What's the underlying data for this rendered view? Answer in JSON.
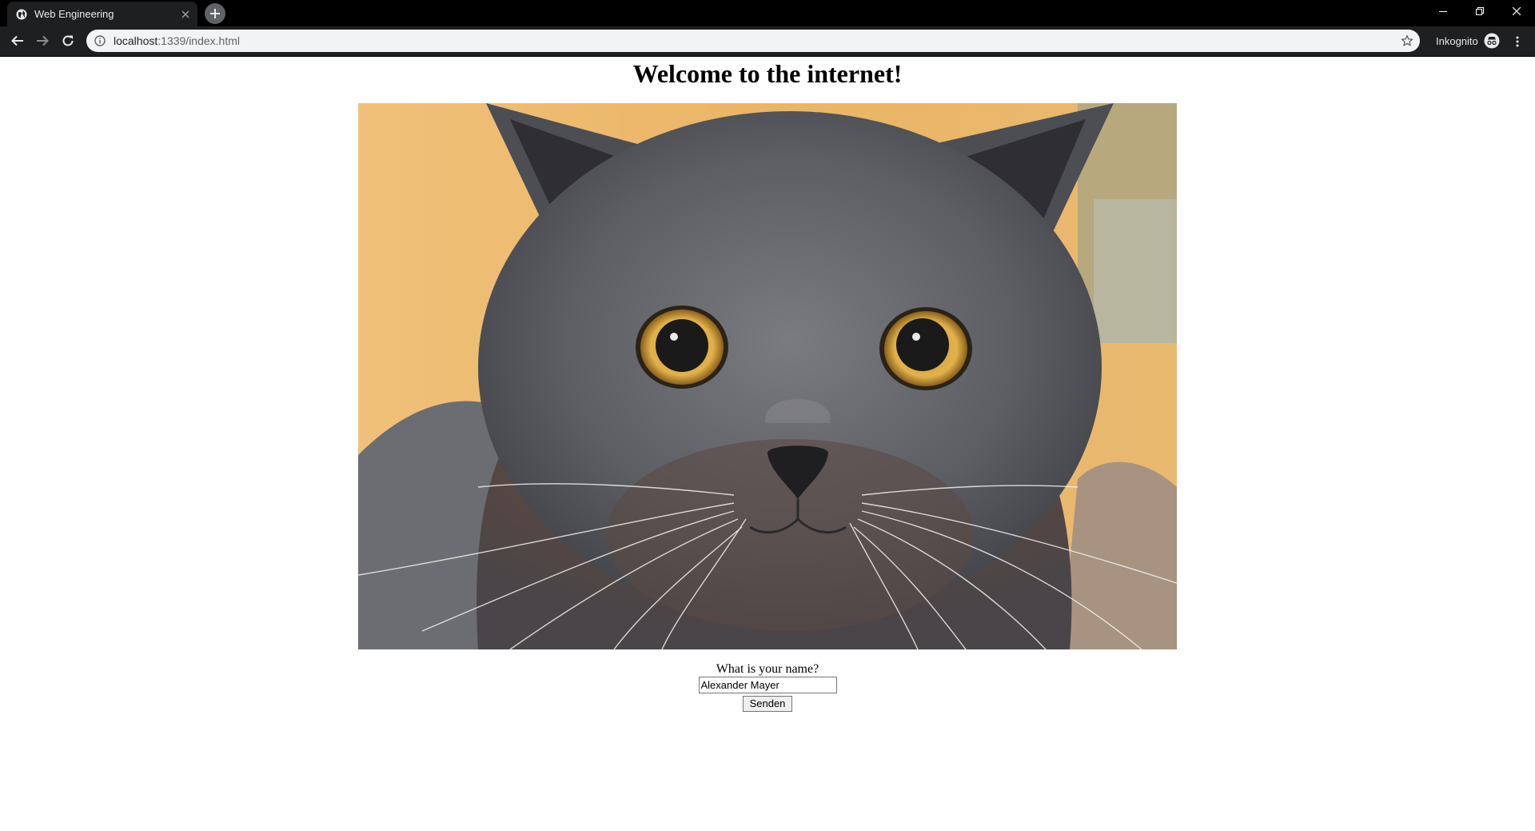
{
  "browser": {
    "tab_title": "Web Engineering",
    "url_host": "localhost",
    "url_path": ":1339/index.html",
    "profile_label": "Inkognito",
    "icons": [
      "globe-icon",
      "close-icon",
      "plus-icon",
      "minimize-icon",
      "maximize-icon",
      "close-window-icon",
      "back-icon",
      "forward-icon",
      "reload-icon",
      "info-icon",
      "star-icon",
      "incognito-icon",
      "menu-icon"
    ]
  },
  "page": {
    "heading": "Welcome to the internet!",
    "image": {
      "subject": "grey-cat-photo"
    },
    "form": {
      "question": "What is your name?",
      "name_value": "Alexander Mayer",
      "submit_label": "Senden"
    }
  },
  "colors": {
    "chrome_dark": "#000000",
    "toolbar": "#1e1f21",
    "omnibox": "#f1f3f4",
    "page_bg": "#ffffff"
  }
}
